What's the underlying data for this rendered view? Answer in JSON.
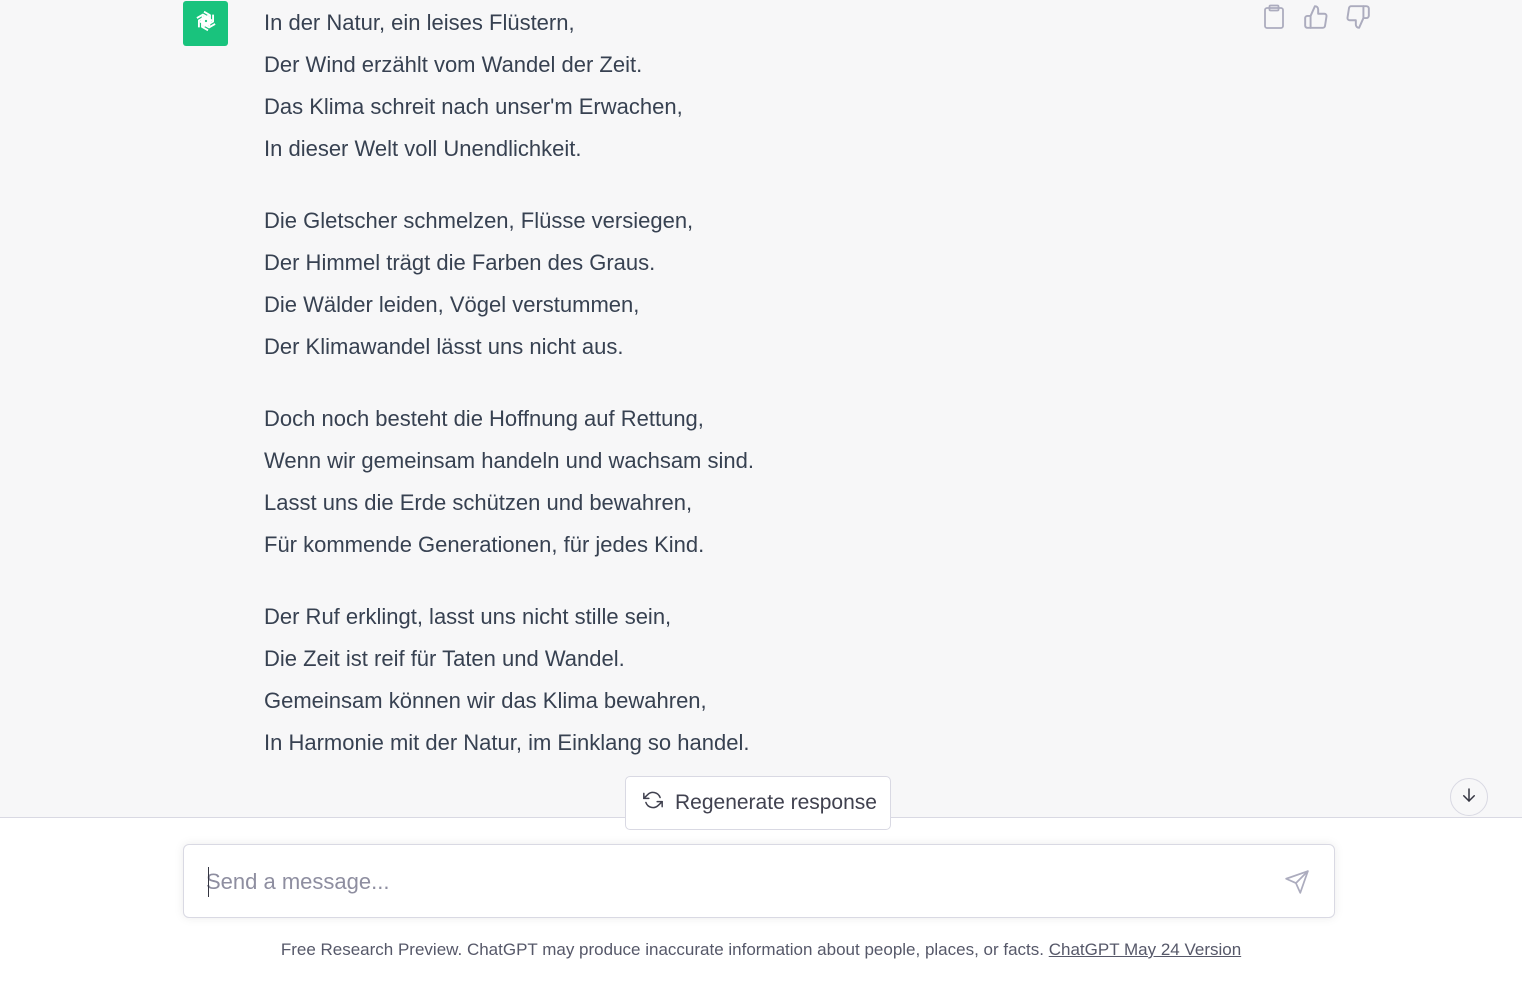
{
  "message": {
    "stanzas": [
      [
        "In der Natur, ein leises Flüstern,",
        "Der Wind erzählt vom Wandel der Zeit.",
        "Das Klima schreit nach unser'm Erwachen,",
        "In dieser Welt voll Unendlichkeit."
      ],
      [
        "Die Gletscher schmelzen, Flüsse versiegen,",
        "Der Himmel trägt die Farben des Graus.",
        "Die Wälder leiden, Vögel verstummen,",
        "Der Klimawandel lässt uns nicht aus."
      ],
      [
        "Doch noch besteht die Hoffnung auf Rettung,",
        "Wenn wir gemeinsam handeln und wachsam sind.",
        "Lasst uns die Erde schützen und bewahren,",
        "Für kommende Generationen, für jedes Kind."
      ],
      [
        "Der Ruf erklingt, lasst uns nicht stille sein,",
        "Die Zeit ist reif für Taten und Wandel.",
        "Gemeinsam können wir das Klima bewahren,",
        "In Harmonie mit der Natur, im Einklang so handel."
      ]
    ]
  },
  "actions": {
    "icons": [
      "clipboard-icon",
      "thumbs-up-icon",
      "thumbs-down-icon"
    ]
  },
  "regenerate": {
    "label": "Regenerate response",
    "icon": "refresh-icon"
  },
  "composer": {
    "placeholder": "Send a message...",
    "value": "",
    "send_icon": "send-icon"
  },
  "footer": {
    "text": "Free Research Preview. ChatGPT may produce inaccurate information about people, places, or facts. ",
    "link": "ChatGPT May 24 Version"
  },
  "colors": {
    "brand": "#19c37d",
    "chat_bg": "#f7f7f8",
    "text": "#374151"
  }
}
